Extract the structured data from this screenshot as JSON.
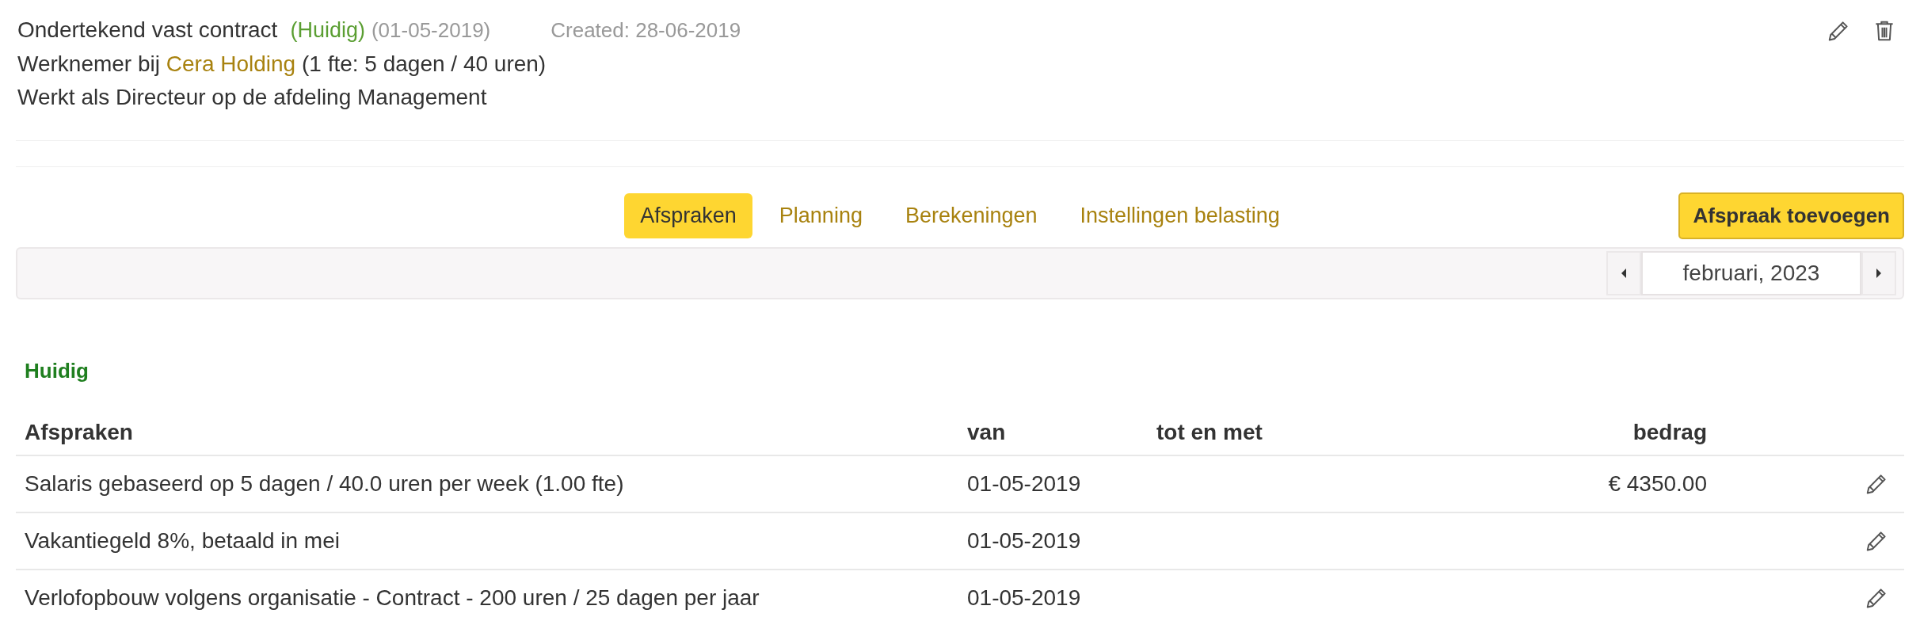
{
  "contract": {
    "title": "Ondertekend vast contract",
    "status": "(Huidig)",
    "start_date": "(01-05-2019)",
    "created": "Created: 28-06-2019",
    "employer_prefix": "Werknemer bij",
    "employer": "Cera Holding",
    "employer_suffix": "(1 fte: 5 dagen / 40 uren)",
    "role": "Werkt als Directeur op de afdeling Management"
  },
  "tabs": [
    {
      "label": "Afspraken",
      "selected": true
    },
    {
      "label": "Planning",
      "selected": false
    },
    {
      "label": "Berekeningen",
      "selected": false
    },
    {
      "label": "Instellingen belasting",
      "selected": false
    }
  ],
  "add_button": "Afspraak toevoegen",
  "period": {
    "value": "februari, 2023"
  },
  "section": {
    "title": "Huidig",
    "columns": [
      "Afspraken",
      "van",
      "tot en met",
      "bedrag"
    ],
    "rows": [
      {
        "description": "Salaris gebaseerd op 5 dagen / 40.0 uren per week (1.00 fte)",
        "from": "01-05-2019",
        "amount": "€ 4350.00"
      },
      {
        "description": "Vakantiegeld 8%, betaald in mei",
        "from": "01-05-2019"
      },
      {
        "description": "Verlofopbouw volgens organisatie - Contract - 200 uren / 25 dagen per jaar",
        "from": "01-05-2019"
      }
    ]
  }
}
